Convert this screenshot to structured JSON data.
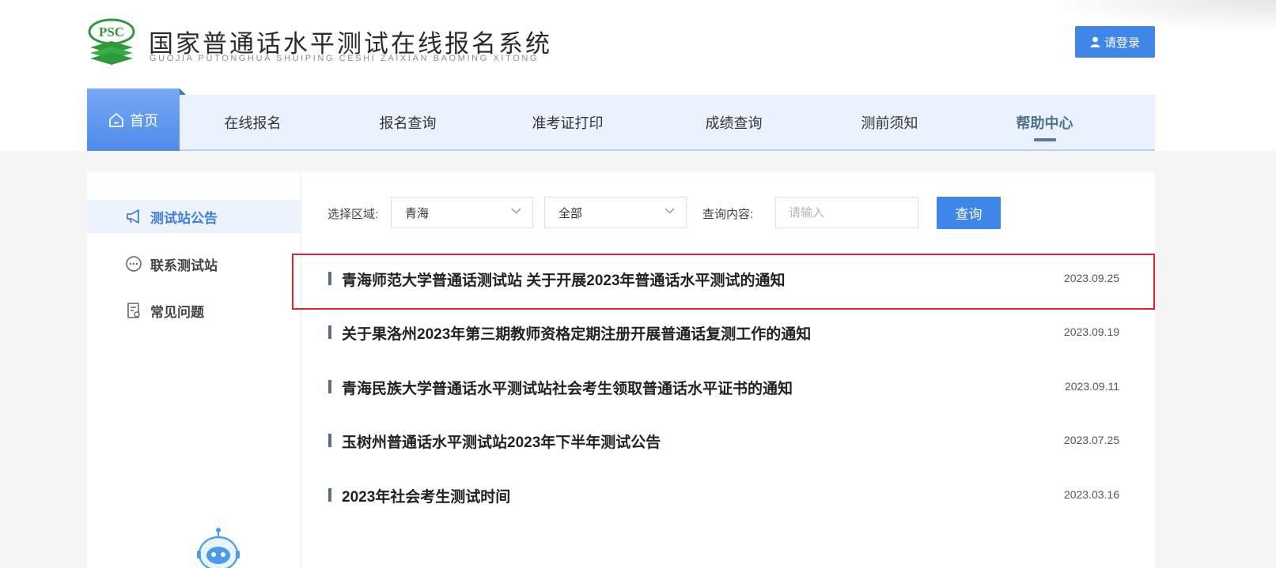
{
  "header": {
    "logo_text": "PSC",
    "title": "国家普通话水平测试在线报名系统",
    "subtitle": "GUOJIA PUTONGHUA SHUIPING CESHI ZAIXIAN BAOMING XITONG",
    "login_label": "请登录",
    "logo_color": "#2e9a3c",
    "accent": "#3e86e8"
  },
  "nav": {
    "items": [
      {
        "label": "首页",
        "icon": "home-icon"
      },
      {
        "label": "在线报名"
      },
      {
        "label": "报名查询"
      },
      {
        "label": "准考证打印"
      },
      {
        "label": "成绩查询"
      },
      {
        "label": "测前须知"
      },
      {
        "label": "帮助中心"
      }
    ],
    "active": "帮助中心"
  },
  "sidebar": {
    "items": [
      {
        "label": "测试站公告",
        "icon": "megaphone-icon",
        "active": true
      },
      {
        "label": "联系测试站",
        "icon": "chat-bubble-icon"
      },
      {
        "label": "常见问题",
        "icon": "document-question-icon"
      }
    ]
  },
  "filters": {
    "region_label": "选择区域:",
    "region_value": "青海",
    "scope_value": "全部",
    "query_label": "查询内容:",
    "query_placeholder": "请输入",
    "query_button": "查询"
  },
  "notices": [
    {
      "title": "青海师范大学普通话测试站 关于开展2023年普通话水平测试的通知",
      "date": "2023.09.25",
      "highlighted": true
    },
    {
      "title": "关于果洛州2023年第三期教师资格定期注册开展普通话复测工作的通知",
      "date": "2023.09.19"
    },
    {
      "title": "青海民族大学普通话水平测试站社会考生领取普通话水平证书的通知",
      "date": "2023.09.11"
    },
    {
      "title": "玉树州普通话水平测试站2023年下半年测试公告",
      "date": "2023.07.25"
    },
    {
      "title": "2023年社会考生测试时间",
      "date": "2023.03.16"
    }
  ],
  "colors": {
    "highlight_border": "#e0242c",
    "nav_background": "#eaf3fd",
    "sidebar_active": "#3f7fdb"
  }
}
